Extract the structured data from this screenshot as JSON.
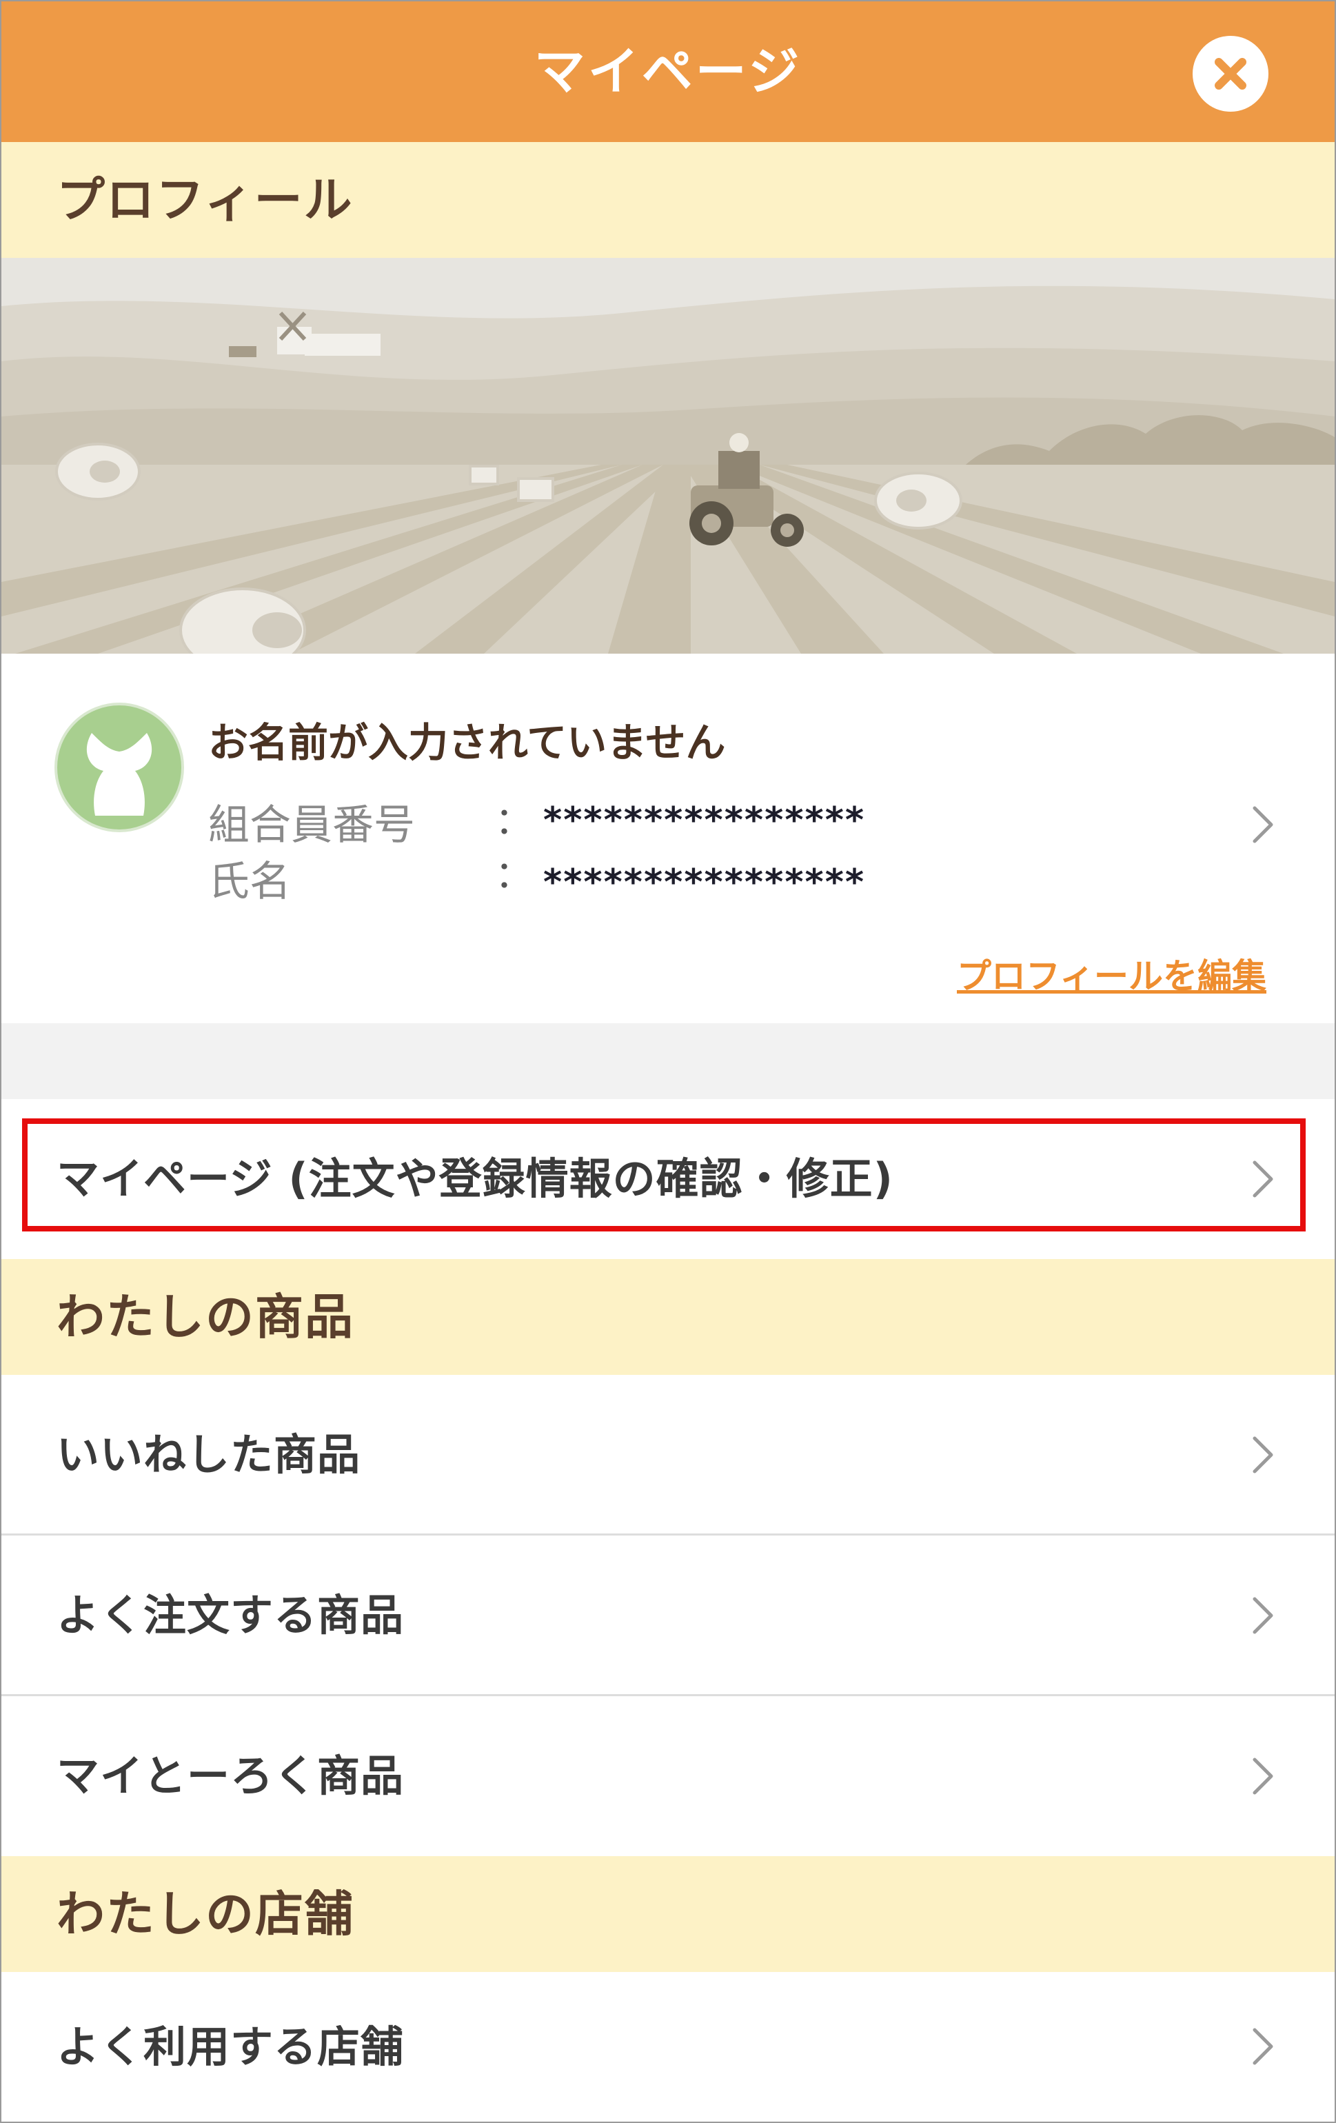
{
  "header": {
    "title": "マイページ",
    "close_icon": "close-icon"
  },
  "profile_section": {
    "title": "プロフィール"
  },
  "profile": {
    "name_placeholder": "お名前が入力されていません",
    "member_number_label": "組合員番号",
    "member_number_value": "****************",
    "full_name_label": "氏名",
    "full_name_value": "****************",
    "colon": "：",
    "edit_link": "プロフィールを編集"
  },
  "mypage_row": {
    "label": "マイページ (注文や登録情報の確認・修正)"
  },
  "products_section": {
    "title": "わたしの商品",
    "items": [
      {
        "label": "いいねした商品"
      },
      {
        "label": "よく注文する商品"
      },
      {
        "label": "マイとーろく商品"
      }
    ]
  },
  "store_section": {
    "title": "わたしの店舗",
    "items": [
      {
        "label": "よく利用する店舗"
      }
    ]
  },
  "colors": {
    "header_bg": "#ee9a46",
    "section_bg": "#fdf2c6",
    "link": "#ee8d2f",
    "highlight": "#e60d0d"
  }
}
